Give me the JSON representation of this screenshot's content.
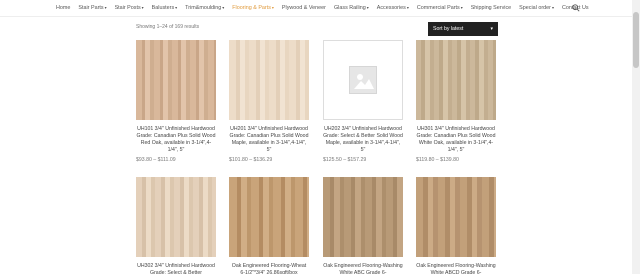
{
  "nav": {
    "items": [
      {
        "label": "Home",
        "caret": false,
        "active": false
      },
      {
        "label": "Stair Parts",
        "caret": true,
        "active": false
      },
      {
        "label": "Stair Posts",
        "caret": true,
        "active": false
      },
      {
        "label": "Balusters",
        "caret": true,
        "active": false
      },
      {
        "label": "Trim&moulding",
        "caret": true,
        "active": false
      },
      {
        "label": "Flooring & Parts",
        "caret": true,
        "active": true
      },
      {
        "label": "Plywood & Veneer",
        "caret": false,
        "active": false
      },
      {
        "label": "Glass Railing",
        "caret": true,
        "active": false
      },
      {
        "label": "Accessories",
        "caret": true,
        "active": false
      },
      {
        "label": "Commercial Parts",
        "caret": true,
        "active": false
      },
      {
        "label": "Shipping Service",
        "caret": false,
        "active": false
      },
      {
        "label": "Special order",
        "caret": true,
        "active": false
      },
      {
        "label": "Contact Us",
        "caret": false,
        "active": false
      }
    ],
    "caret_glyph": "▾",
    "accent_color": "#e09a3c"
  },
  "results": {
    "text": "Showing 1–24 of 169 results"
  },
  "sort": {
    "selected": "Sort by latest",
    "chevron": "▾"
  },
  "products": [
    {
      "title": "UH101 3/4'' Unfinished Hardwood Grade: Canadian Plus Solid Wood Red Oak, available in 3-1/4\",4-1/4\", 5\"",
      "price": "$93.80 – $111.09"
    },
    {
      "title": "UH201 3/4'' Unfinished Hardwood Grade: Canadian Plus Solid Wood Maple, available in 3-1/4\",4-1/4\", 5\"",
      "price": "$101.80 – $136.29"
    },
    {
      "title": "UH202 3/4'' Unfinished Hardwood Grade: Select & Better Solid Wood Maple, available in 3-1/4\",4-1/4\", 5\"",
      "price": "$125.50 – $157.29"
    },
    {
      "title": "UH301 3/4'' Unfinished Hardwood Grade: Canadian Plus Solid Wood White Oak, available in 3-1/4\",4-1/4\", 5\"",
      "price": "$119.80 – $139.80"
    },
    {
      "title": "UH302 3/4'' Unfinished Hardwood Grade: Select & Better",
      "price": ""
    },
    {
      "title": "Oak Engineered Flooring-Wheat 6-1/2\"*3/4\" 26.86sqft/box",
      "price": ""
    },
    {
      "title": "Oak Engineered Flooring-Washing White ABC Grade 6-",
      "price": ""
    },
    {
      "title": "Oak Engineered Flooring-Washing White ABCD Grade 6-",
      "price": ""
    }
  ]
}
